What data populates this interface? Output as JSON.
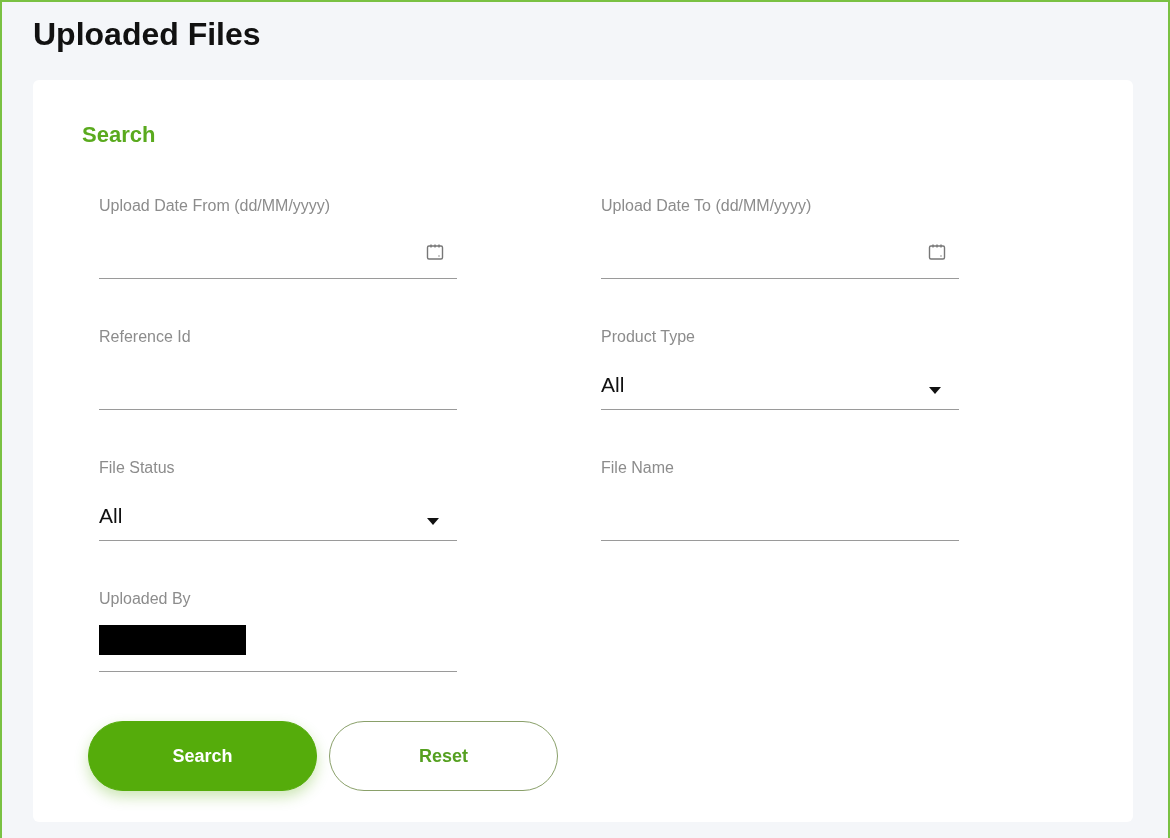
{
  "page_title": "Uploaded Files",
  "search_panel": {
    "heading": "Search",
    "fields": [
      {
        "kind": "date",
        "label": "Upload Date From (dd/MM/yyyy)"
      },
      {
        "kind": "date",
        "label": "Upload Date To (dd/MM/yyyy)"
      },
      {
        "kind": "text",
        "label": "Reference Id"
      },
      {
        "kind": "select",
        "label": "Product Type",
        "value": "All"
      },
      {
        "kind": "select",
        "label": "File Status",
        "value": "All"
      },
      {
        "kind": "text",
        "label": "File Name"
      },
      {
        "kind": "text",
        "label": "Uploaded By",
        "redacted": true
      }
    ]
  },
  "buttons": [
    {
      "label": "Search",
      "kind": "primary"
    },
    {
      "label": "Reset",
      "kind": "secondary"
    }
  ]
}
